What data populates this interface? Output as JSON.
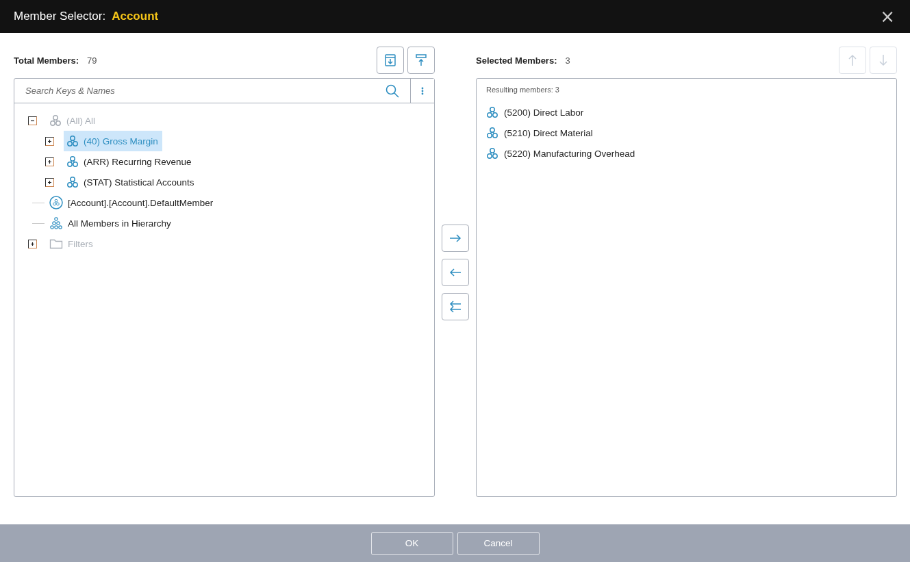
{
  "window": {
    "title": "Member Selector:",
    "subject": "Account",
    "close": "×"
  },
  "left": {
    "label": "Total Members:",
    "count": "79",
    "tools": [
      {
        "kind": "download",
        "disabled": false
      },
      {
        "kind": "upload",
        "disabled": false
      }
    ],
    "search": {
      "placeholder": "Search Keys & Names"
    },
    "tree": [
      {
        "kind": "member",
        "label": "(All) All",
        "expanded": true,
        "disabled": true,
        "selected": false,
        "children": [
          {
            "kind": "member",
            "label": "(40) Gross Margin",
            "expanded": false,
            "disabled": false,
            "selected": true
          },
          {
            "kind": "member",
            "label": "(ARR) Recurring Revenue",
            "expanded": false,
            "disabled": false,
            "selected": false
          },
          {
            "kind": "member",
            "label": "(STAT) Statistical Accounts",
            "expanded": false,
            "disabled": false,
            "selected": false
          }
        ]
      },
      {
        "kind": "default",
        "label": "[Account].[Account].DefaultMember",
        "disabled": false,
        "selected": false
      },
      {
        "kind": "all-members",
        "label": "All Members in Hierarchy",
        "disabled": false,
        "selected": false
      },
      {
        "kind": "folder",
        "label": "Filters",
        "expanded": false,
        "disabled": true,
        "selected": false
      }
    ]
  },
  "transfer": [
    {
      "kind": "add"
    },
    {
      "kind": "remove"
    },
    {
      "kind": "remove-all"
    }
  ],
  "right": {
    "label": "Selected Members:",
    "count": "3",
    "tools": [
      {
        "kind": "up",
        "disabled": true
      },
      {
        "kind": "down",
        "disabled": true
      }
    ],
    "summary": "Resulting members: 3",
    "items": [
      {
        "kind": "member",
        "label": "(5200) Direct Labor"
      },
      {
        "kind": "member",
        "label": "(5210) Direct Material"
      },
      {
        "kind": "member",
        "label": "(5220) Manufacturing Overhead"
      }
    ]
  },
  "buttons": [
    "OK",
    "Cancel"
  ]
}
